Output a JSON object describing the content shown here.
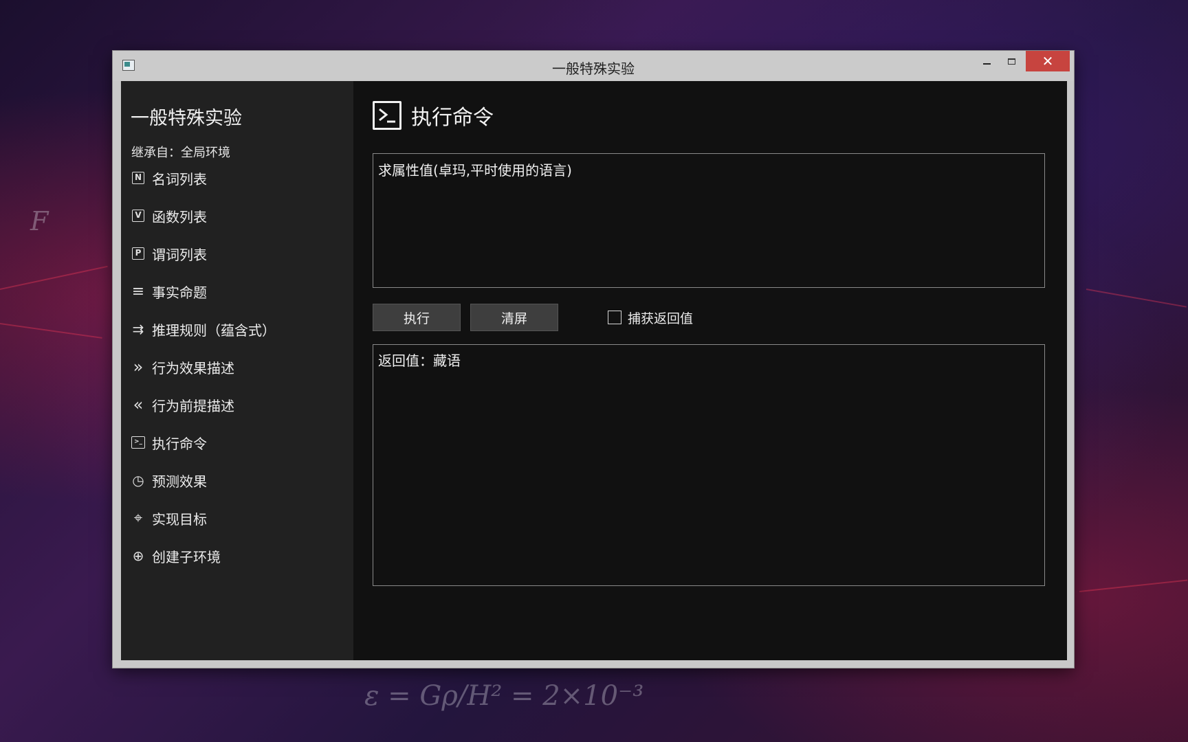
{
  "window": {
    "title": "一般特殊实验",
    "close_glyph": "✕"
  },
  "sidebar": {
    "title": "一般特殊实验",
    "inherit_text": "继承自：全局环境",
    "items": [
      {
        "label": "名词列表",
        "icon": "noun-list-icon",
        "glyph": "N"
      },
      {
        "label": "函数列表",
        "icon": "function-list-icon",
        "glyph": "V"
      },
      {
        "label": "谓词列表",
        "icon": "predicate-list-icon",
        "glyph": "P"
      },
      {
        "label": "事实命题",
        "icon": "list-lines-icon",
        "glyph": "≡"
      },
      {
        "label": "推理规则（蕴含式）",
        "icon": "arrows-right-icon",
        "glyph": "⇉"
      },
      {
        "label": "行为效果描述",
        "icon": "double-chevron-right-icon",
        "glyph": "»"
      },
      {
        "label": "行为前提描述",
        "icon": "double-chevron-left-icon",
        "glyph": "«"
      },
      {
        "label": "执行命令",
        "icon": "terminal-icon",
        "glyph": ">_"
      },
      {
        "label": "预测效果",
        "icon": "clock-icon",
        "glyph": "◷"
      },
      {
        "label": "实现目标",
        "icon": "target-icon",
        "glyph": "⌖"
      },
      {
        "label": "创建子环境",
        "icon": "plus-circle-icon",
        "glyph": "⊕"
      }
    ]
  },
  "main": {
    "title": "执行命令",
    "command_text": "求属性值(卓玛,平时使用的语言)",
    "run_label": "执行",
    "clear_label": "清屏",
    "capture_label": "捕获返回值",
    "capture_checked": false,
    "output_text": "返回值：藏语"
  }
}
